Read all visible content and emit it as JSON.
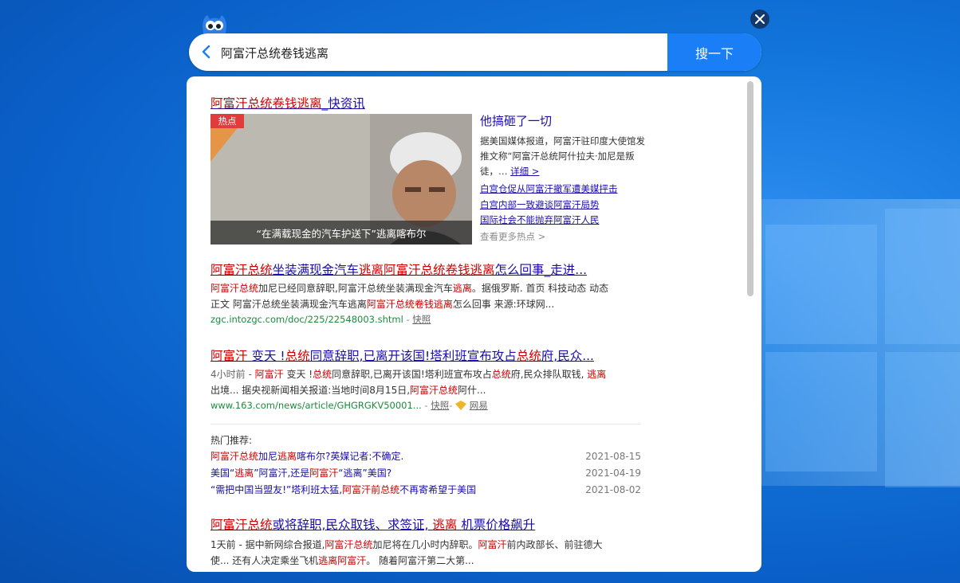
{
  "search": {
    "query": "阿富汗总统卷钱逃离",
    "button_label": "搜一下"
  },
  "results": {
    "r1": {
      "title_hl": "阿富汗总统卷钱逃离",
      "title_rest": "_快资讯",
      "hot_tag": "热点",
      "caption_a": "“在满载现金的汽车护送下”",
      "caption_b": "逃离喀布尔",
      "side_title": "他搞砸了一切",
      "side_desc": "据美国媒体报道，阿富汗驻印度大使馆发推文称“阿富汗总统阿什拉夫·加尼是叛徒，…",
      "side_more_link": "详细 >",
      "side_links": [
        "白宫仓促从阿富汗撤军遭美媒抨击",
        "白宫内部一致避谈阿富汗局势",
        "国际社会不能抛弃阿富汗人民"
      ],
      "more_hot": "查看更多热点 >"
    },
    "r2": {
      "title_a": "阿富汗总统",
      "title_b": "坐装满现金汽车",
      "title_c": "逃离阿富汗总统卷钱逃离",
      "title_d": "怎么回事_走进...",
      "snip_line1_a": "阿富汗总统",
      "snip_line1_b": "加尼已经同意辞职,阿富汗总统坐装满现金汽车",
      "snip_line1_c": "逃离",
      "snip_line1_d": "。据俄罗斯. 首页 科技动态 动态",
      "snip_line2_a": "正文 阿富汗总统坐装满现金汽车逃离",
      "snip_line2_b": "阿富汗总统卷钱逃离",
      "snip_line2_c": "怎么回事 来源:环球网...",
      "url": "zgc.intozgc.com/doc/225/22548003.shtml",
      "sep": " - ",
      "cache": "快照"
    },
    "r3": {
      "title_a": "阿富汗",
      "title_b": " 变天 !",
      "title_c": "总统",
      "title_d": "同意辞职,已离开该国!塔利班宣布攻占",
      "title_e": "总统",
      "title_f": "府,民众...",
      "snip_line1": "4小时前 - ",
      "snip_l1_a": "阿富汗",
      "snip_l1_b": " 变天 !",
      "snip_l1_c": "总统",
      "snip_l1_d": "同意辞职,已离开该国!塔利班宣布攻占",
      "snip_l1_e": "总统",
      "snip_l1_f": "府,民众排队取钱, ",
      "snip_l1_g": "逃离",
      "snip_line2_a": "出境... 据央视新闻相关报道:当地时间8月15日,",
      "snip_line2_b": "阿富汗总统",
      "snip_line2_c": "阿什...",
      "url": "www.163.com/news/article/GHGRGKV50001...",
      "sep": " - ",
      "cache": "快照",
      "dash": "- ",
      "source": "网易"
    },
    "hot": {
      "header": "热门推荐:",
      "items": [
        {
          "a": "阿富汗总统",
          "b": "加尼",
          "c": "逃离",
          "d": "喀布尔?英媒记者:不确定.",
          "date": "2021-08-15"
        },
        {
          "a": "美国“",
          "b": "逃离",
          "c": "”阿富汗,还是",
          "d": "阿富汗",
          "e": "“逃离”美国?",
          "date": "2021-04-19"
        },
        {
          "a": "“需把中国当盟友!”塔利班太猛,",
          "b": "阿富汗前总统",
          "c": "不再寄希望于美国",
          "date": "2021-08-02"
        }
      ]
    },
    "r4": {
      "title_a": "阿富汗总统",
      "title_b": "或将辞职,民众取钱、求签证, ",
      "title_c": "逃离",
      "title_d": " 机票价格飙升",
      "snip_line1_a": "1天前 - 据中新网综合报道,",
      "snip_line1_b": "阿富汗总统",
      "snip_line1_c": "加尼将在几小时内辞职。",
      "snip_line1_d": "阿富汗",
      "snip_line1_e": "前内政部长、前驻德大",
      "snip_line2_a": "使... 还有人决定乘坐飞机",
      "snip_line2_b": "逃离阿富汗",
      "snip_line2_c": "。 随着阿富汗第二大第..."
    }
  }
}
